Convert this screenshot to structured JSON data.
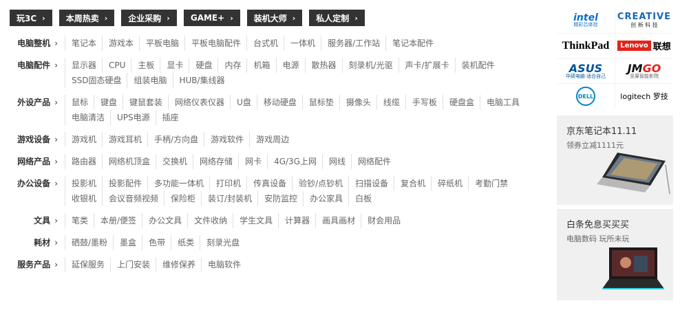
{
  "top_tags": [
    "玩3C",
    "本周热卖",
    "企业采购",
    "GAME+",
    "装机大师",
    "私人定制"
  ],
  "categories": [
    {
      "title": "电脑整机",
      "links": [
        "笔记本",
        "游戏本",
        "平板电脑",
        "平板电脑配件",
        "台式机",
        "一体机",
        "服务器/工作站",
        "笔记本配件"
      ]
    },
    {
      "title": "电脑配件",
      "links": [
        "显示器",
        "CPU",
        "主板",
        "显卡",
        "硬盘",
        "内存",
        "机箱",
        "电源",
        "散热器",
        "刻录机/光驱",
        "声卡/扩展卡",
        "装机配件",
        "SSD固态硬盘",
        "组装电脑",
        "HUB/集线器"
      ]
    },
    {
      "title": "外设产品",
      "links": [
        "鼠标",
        "键盘",
        "键鼠套装",
        "网络仪表仪器",
        "U盘",
        "移动硬盘",
        "鼠标垫",
        "摄像头",
        "线缆",
        "手写板",
        "硬盘盒",
        "电脑工具",
        "电脑清洁",
        "UPS电源",
        "插座"
      ]
    },
    {
      "title": "游戏设备",
      "links": [
        "游戏机",
        "游戏耳机",
        "手柄/方向盘",
        "游戏软件",
        "游戏周边"
      ]
    },
    {
      "title": "网络产品",
      "links": [
        "路由器",
        "网络机顶盒",
        "交换机",
        "网络存储",
        "网卡",
        "4G/3G上网",
        "网线",
        "网络配件"
      ]
    },
    {
      "title": "办公设备",
      "links": [
        "投影机",
        "投影配件",
        "多功能一体机",
        "打印机",
        "传真设备",
        "验钞/点钞机",
        "扫描设备",
        "复合机",
        "碎纸机",
        "考勤门禁",
        "收银机",
        "会议音频视频",
        "保险柜",
        "装订/封装机",
        "安防监控",
        "办公家具",
        "白板"
      ]
    },
    {
      "title": "文具",
      "links": [
        "笔类",
        "本册/便签",
        "办公文具",
        "文件收纳",
        "学生文具",
        "计算器",
        "画具画材",
        "财会用品"
      ]
    },
    {
      "title": "耗材",
      "links": [
        "硒鼓/墨粉",
        "墨盒",
        "色带",
        "纸类",
        "刻录光盘"
      ]
    },
    {
      "title": "服务产品",
      "links": [
        "延保服务",
        "上门安装",
        "维修保养",
        "电脑软件"
      ]
    }
  ],
  "brands": {
    "intel": "intel",
    "intel_sub": "精彩芯体验",
    "creative": "CREATIVE",
    "creative_sub": "创 新 科 技",
    "thinkpad": "ThinkPad",
    "lenovo": "Lenovo",
    "lenovo_cn": "联想",
    "asus": "ASUS",
    "asus_sub": "华硕电脑·适合自己",
    "jmgo_a": "JM",
    "jmgo_b": "GO",
    "jmgo_sub": "坚果智能影院",
    "dell": "DELL",
    "logitech": "logitech 罗技"
  },
  "promos": [
    {
      "title": "京东笔记本11.11",
      "subtitle": "领券立减1111元"
    },
    {
      "title": "白条免息买买买",
      "subtitle": "电脑数码 玩所未玩"
    }
  ],
  "colors": {
    "tag_bg": "#333333",
    "promo_bg": "#f0f0f0",
    "hover": "#e4393c"
  }
}
